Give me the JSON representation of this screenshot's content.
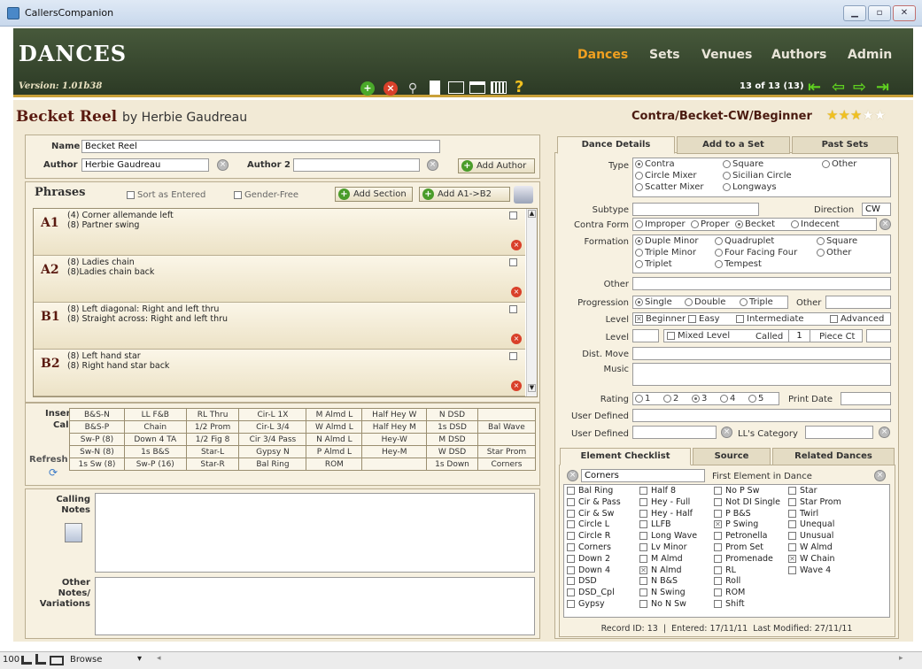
{
  "window": {
    "title": "CallersCompanion"
  },
  "header": {
    "title": "Dances",
    "version": "Version: 1.01b38",
    "nav": [
      "Dances",
      "Sets",
      "Venues",
      "Authors",
      "Admin"
    ],
    "record_count": "13 of 13 (13)",
    "help": "?"
  },
  "dance": {
    "name_title": "Becket Reel",
    "by": "by Herbie Gaudreau",
    "category": "Contra/Becket-CW/Beginner",
    "rating_stars": 3,
    "rating_max": 5
  },
  "form": {
    "name_label": "Name",
    "name_value": "Becket Reel",
    "author_label": "Author",
    "author_value": "Herbie Gaudreau",
    "author2_label": "Author 2",
    "author2_value": "",
    "add_author": "Add Author"
  },
  "phrases": {
    "label": "Phrases",
    "sort_label": "Sort as Entered",
    "gender_label": "Gender-Free",
    "add_section": "Add Section",
    "add_a1b2": "Add A1->B2",
    "items": [
      {
        "code": "A1",
        "lines": [
          "(4) Corner allemande left",
          "(8) Partner swing"
        ]
      },
      {
        "code": "A2",
        "lines": [
          "(8) Ladies chain",
          "(8)Ladies chain back"
        ]
      },
      {
        "code": "B1",
        "lines": [
          "(8) Left diagonal: Right and left thru",
          "(8) Straight across: Right and left thru"
        ]
      },
      {
        "code": "B2",
        "lines": [
          "(8) Left hand star",
          "(8) Right hand star back"
        ]
      }
    ]
  },
  "calls": {
    "insert_label": "Insert",
    "call_label": "Call",
    "refresh_label": "Refresh",
    "rows": [
      [
        "B&S-N",
        "LL F&B",
        "RL Thru",
        "Cir-L 1X",
        "M Almd L",
        "Half Hey W",
        "N DSD",
        ""
      ],
      [
        "B&S-P",
        "Chain",
        "1/2 Prom",
        "Cir-L 3/4",
        "W Almd L",
        "Half Hey M",
        "1s DSD",
        "Bal Wave"
      ],
      [
        "Sw-P (8)",
        "Down 4 TA",
        "1/2 Fig 8",
        "Cir 3/4 Pass",
        "N Almd L",
        "Hey-W",
        "M DSD",
        ""
      ],
      [
        "Sw-N (8)",
        "1s B&S",
        "Star-L",
        "Gypsy N",
        "P Almd L",
        "Hey-M",
        "W DSD",
        "Star Prom"
      ],
      [
        "1s Sw (8)",
        "Sw-P (16)",
        "Star-R",
        "Bal Ring",
        "ROM",
        "",
        "1s Down",
        "Corners"
      ]
    ]
  },
  "notes": {
    "calling_label": "Calling\nNotes",
    "other_label": "Other\nNotes/\nVariations",
    "calling_value": "",
    "other_value": ""
  },
  "tabs_top": [
    "Dance Details",
    "Add to a Set",
    "Past Sets"
  ],
  "details": {
    "type_label": "Type",
    "type_options": [
      [
        "Contra",
        "Square",
        "Other"
      ],
      [
        "Circle Mixer",
        "Sicilian Circle",
        ""
      ],
      [
        "Scatter Mixer",
        "Longways",
        ""
      ]
    ],
    "type_selected": "Contra",
    "subtype_label": "Subtype",
    "subtype_value": "",
    "direction_label": "Direction",
    "direction_value": "CW",
    "contraform_label": "Contra Form",
    "contraform_options": [
      "Improper",
      "Proper",
      "Becket",
      "Indecent"
    ],
    "contraform_selected": "Becket",
    "formation_label": "Formation",
    "formation_options": [
      [
        "Duple Minor",
        "Quadruplet",
        "Square"
      ],
      [
        "Triple Minor",
        "Four Facing Four",
        "Other"
      ],
      [
        "Triplet",
        "Tempest",
        ""
      ]
    ],
    "formation_selected": "Duple Minor",
    "other_label": "Other",
    "other_value": "",
    "progression_label": "Progression",
    "progression_options": [
      "Single",
      "Double",
      "Triple"
    ],
    "progression_selected": "Single",
    "progression_other_label": "Other",
    "progression_other_value": "",
    "level_label": "Level",
    "level_options": [
      "Beginner",
      "Easy",
      "Intermediate",
      "Advanced"
    ],
    "level_checked": "Beginner",
    "level2_label": "Level",
    "level2_value": "",
    "mixed_level_label": "Mixed Level",
    "called_label": "Called",
    "called_value": "1",
    "piece_label": "Piece Ct",
    "piece_value": "",
    "distmove_label": "Dist. Move",
    "distmove_value": "",
    "music_label": "Music",
    "music_value": "",
    "rating_label": "Rating",
    "rating_options": [
      "1",
      "2",
      "3",
      "4",
      "5"
    ],
    "rating_selected": "3",
    "printdate_label": "Print Date",
    "printdate_value": "",
    "userdef1_label": "User Defined",
    "userdef1_value": "",
    "userdef2_label": "User Defined",
    "userdef2_value": "",
    "llcat_label": "LL's Category",
    "llcat_value": ""
  },
  "tabs_bottom": [
    "Element Checklist",
    "Source",
    "Related Dances"
  ],
  "checklist": {
    "corners_value": "Corners",
    "first_label": "First Element in Dance",
    "columns": [
      [
        [
          "Bal Ring",
          false
        ],
        [
          "Cir & Pass",
          false
        ],
        [
          "Cir & Sw",
          false
        ],
        [
          "Circle L",
          false
        ],
        [
          "Circle R",
          false
        ],
        [
          "Corners",
          false
        ],
        [
          "Down 2",
          false
        ],
        [
          "Down 4",
          false
        ],
        [
          "DSD",
          false
        ],
        [
          "DSD_Cpl",
          false
        ],
        [
          "Gypsy",
          false
        ]
      ],
      [
        [
          "Half 8",
          false
        ],
        [
          "Hey - Full",
          false
        ],
        [
          "Hey - Half",
          false
        ],
        [
          "LLFB",
          false
        ],
        [
          "Long Wave",
          false
        ],
        [
          "Lv Minor",
          false
        ],
        [
          "M Almd",
          false
        ],
        [
          "N Almd",
          true
        ],
        [
          "N B&S",
          false
        ],
        [
          "N Swing",
          false
        ],
        [
          "No N Sw",
          false
        ]
      ],
      [
        [
          "No P Sw",
          false
        ],
        [
          "Not DI Single",
          false
        ],
        [
          "P B&S",
          false
        ],
        [
          "P Swing",
          true
        ],
        [
          "Petronella",
          false
        ],
        [
          "Prom Set",
          false
        ],
        [
          "Promenade",
          false
        ],
        [
          "RL",
          false
        ],
        [
          "Roll",
          false
        ],
        [
          "ROM",
          false
        ],
        [
          "Shift",
          false
        ]
      ],
      [
        [
          "Star",
          false
        ],
        [
          "Star Prom",
          false
        ],
        [
          "Twirl",
          false
        ],
        [
          "Unequal",
          false
        ],
        [
          "Unusual",
          false
        ],
        [
          "W Almd",
          false
        ],
        [
          "W Chain",
          true
        ],
        [
          "Wave 4",
          false
        ]
      ]
    ]
  },
  "record": "Record ID: 13  |  Entered: 17/11/11  Last Modified: 27/11/11",
  "statusbar": {
    "zoom": "100",
    "mode": "Browse"
  }
}
